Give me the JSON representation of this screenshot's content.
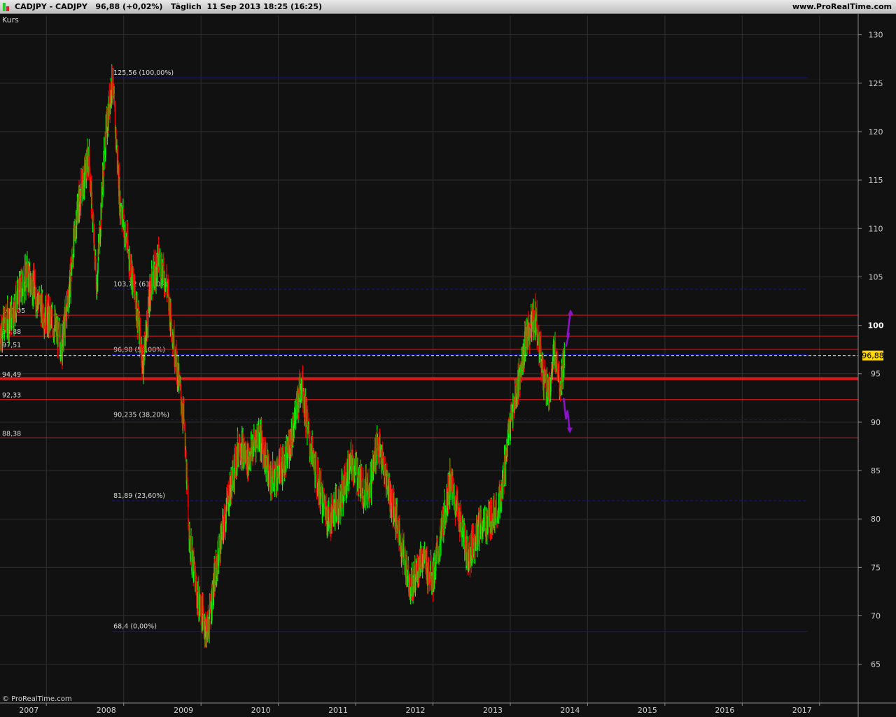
{
  "header": {
    "symbol": "CADJPY - CADJPY",
    "price": "96,88 (+0,02%)",
    "period": "Täglich  11 Sep 2013 18:25 (16:25)",
    "site": "www.ProRealTime.com"
  },
  "panel_label": "Kurs",
  "copyright": "© ProRealTime.com",
  "colors": {
    "background": "#111111",
    "grid": "#2e2e2e",
    "up": "#00ff00",
    "down": "#ff0000",
    "fib_line": "#1010c0",
    "hline": "#e01818",
    "arrow": "#9010d0",
    "price_tag": "#ffd700"
  },
  "chart_data": {
    "type": "candlestick",
    "instrument": "CADJPY",
    "interval": "daily",
    "ylim": [
      61,
      132
    ],
    "xlim": [
      2006.4,
      2017.5
    ],
    "yticks": [
      65,
      70,
      75,
      80,
      85,
      90,
      95,
      100,
      105,
      110,
      115,
      120,
      125,
      130
    ],
    "xticks": [
      2007,
      2008,
      2009,
      2010,
      2011,
      2012,
      2013,
      2014,
      2015,
      2016,
      2017
    ],
    "last_price": 96.88,
    "last_price_label": "96,88",
    "price_path": [
      [
        2006.4,
        99.5
      ],
      [
        2006.55,
        101
      ],
      [
        2006.75,
        105.5
      ],
      [
        2006.95,
        101.5
      ],
      [
        2007.1,
        100
      ],
      [
        2007.2,
        98
      ],
      [
        2007.3,
        104
      ],
      [
        2007.4,
        112
      ],
      [
        2007.55,
        117.5
      ],
      [
        2007.65,
        104
      ],
      [
        2007.75,
        118
      ],
      [
        2007.85,
        125.56
      ],
      [
        2007.95,
        113
      ],
      [
        2008.05,
        108
      ],
      [
        2008.15,
        103
      ],
      [
        2008.25,
        96
      ],
      [
        2008.35,
        104
      ],
      [
        2008.45,
        107
      ],
      [
        2008.55,
        104.5
      ],
      [
        2008.7,
        95
      ],
      [
        2008.78,
        90
      ],
      [
        2008.85,
        78
      ],
      [
        2008.95,
        72
      ],
      [
        2009.08,
        68.4
      ],
      [
        2009.2,
        75
      ],
      [
        2009.35,
        82
      ],
      [
        2009.5,
        88
      ],
      [
        2009.6,
        86
      ],
      [
        2009.75,
        89
      ],
      [
        2009.9,
        84
      ],
      [
        2010.1,
        86
      ],
      [
        2010.25,
        92
      ],
      [
        2010.3,
        94.49
      ],
      [
        2010.4,
        88
      ],
      [
        2010.5,
        84
      ],
      [
        2010.65,
        80
      ],
      [
        2010.8,
        82
      ],
      [
        2010.95,
        86
      ],
      [
        2011.1,
        83
      ],
      [
        2011.2,
        84
      ],
      [
        2011.28,
        88
      ],
      [
        2011.4,
        84
      ],
      [
        2011.5,
        81
      ],
      [
        2011.6,
        77
      ],
      [
        2011.72,
        73
      ],
      [
        2011.85,
        76
      ],
      [
        2012.0,
        74
      ],
      [
        2012.1,
        78
      ],
      [
        2012.22,
        84
      ],
      [
        2012.35,
        80
      ],
      [
        2012.45,
        76
      ],
      [
        2012.6,
        79
      ],
      [
        2012.75,
        80
      ],
      [
        2012.88,
        82
      ],
      [
        2012.98,
        89
      ],
      [
        2013.1,
        94
      ],
      [
        2013.22,
        99
      ],
      [
        2013.33,
        101.05
      ],
      [
        2013.42,
        95
      ],
      [
        2013.5,
        93
      ],
      [
        2013.58,
        97.5
      ],
      [
        2013.65,
        94
      ],
      [
        2013.7,
        96.88
      ]
    ],
    "fibonacci_levels": [
      {
        "value": 125.56,
        "label": "125,56 (100,00%)",
        "style": "solid"
      },
      {
        "value": 103.72,
        "label": "103,72 (61,80%)",
        "style": "dashed"
      },
      {
        "value": 96.98,
        "label": "96,98 (50,00%)",
        "style": "solid"
      },
      {
        "value": 90.235,
        "label": "90,235 (38,20%)",
        "style": "dashed"
      },
      {
        "value": 81.89,
        "label": "81,89 (23,60%)",
        "style": "dashed"
      },
      {
        "value": 68.4,
        "label": "68,4 (0,00%)",
        "style": "solid"
      }
    ],
    "horizontal_lines": [
      {
        "value": 101.05,
        "label": "101,05",
        "width": 1
      },
      {
        "value": 98.88,
        "label": "98,88",
        "width": 1
      },
      {
        "value": 97.51,
        "label": "97,51",
        "width": 1
      },
      {
        "value": 94.49,
        "label": "94,49",
        "width": 4
      },
      {
        "value": 92.33,
        "label": "92,33",
        "width": 1
      },
      {
        "value": 88.38,
        "label": "88,38",
        "width": 1
      }
    ],
    "projection_arrows": [
      {
        "direction": "up",
        "points": [
          [
            2013.72,
            97.8
          ],
          [
            2013.76,
            99.2
          ],
          [
            2013.74,
            99.0
          ],
          [
            2013.78,
            101.5
          ]
        ]
      },
      {
        "direction": "down",
        "points": [
          [
            2013.69,
            92.5
          ],
          [
            2013.72,
            90.3
          ],
          [
            2013.74,
            91.2
          ],
          [
            2013.77,
            89.0
          ]
        ]
      }
    ]
  }
}
